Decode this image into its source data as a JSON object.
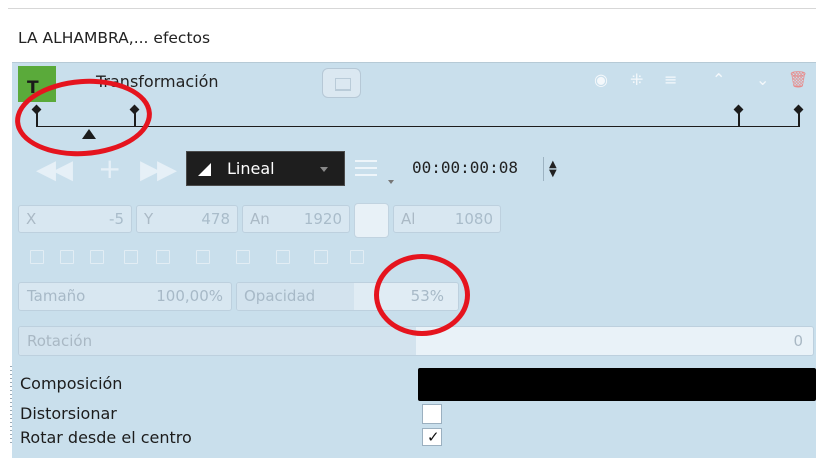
{
  "panel": {
    "title": "LA ALHAMBRA,... efectos"
  },
  "effect": {
    "badge": "T",
    "name": "Transformación"
  },
  "header_icons": {
    "visibility": "eye-icon",
    "keyframe_type": "keyframe-icon",
    "menu": "menu-icon",
    "move_up": "chevron-up-icon",
    "move_down": "chevron-down-icon",
    "delete": "trash-icon"
  },
  "keyframes": {
    "count": 4,
    "cursor_frame": 8
  },
  "toolbar": {
    "interpolation": "Lineal",
    "timecode": "00:00:00:08"
  },
  "geometry": {
    "x_label": "X",
    "x_value": "-5",
    "y_label": "Y",
    "y_value": "478",
    "w_label": "An",
    "w_value": "1920",
    "h_label": "Al",
    "h_value": "1080"
  },
  "params": {
    "size_label": "Tamaño",
    "size_value": "100,00%",
    "opacity_label": "Opacidad",
    "opacity_value": "53%",
    "opacity_fraction": 0.53,
    "rotation_label": "Rotación",
    "rotation_value": "0",
    "rotation_fraction": 0.5
  },
  "options": {
    "composition_label": "Composición",
    "distort_label": "Distorsionar",
    "distort_checked": false,
    "rotate_center_label": "Rotar desde el centro",
    "rotate_center_checked": true,
    "check_mark": "✓"
  },
  "colors": {
    "panel_bg": "#c9dfec",
    "badge_green": "#5aaa3a",
    "annotation_red": "#e5141e"
  }
}
